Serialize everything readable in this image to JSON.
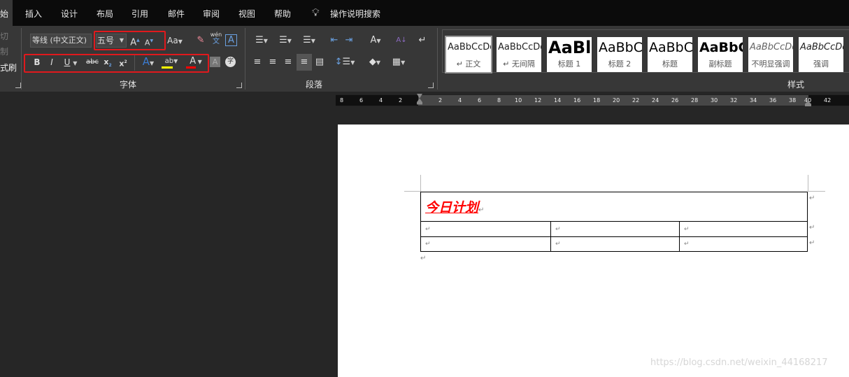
{
  "tabs": [
    "始",
    "插入",
    "设计",
    "布局",
    "引用",
    "邮件",
    "审阅",
    "视图",
    "帮助"
  ],
  "search": {
    "icon": "lightbulb-icon",
    "label": "操作说明搜索"
  },
  "clipboard": {
    "items": [
      "切",
      "制",
      "式刷"
    ]
  },
  "font": {
    "name": "等线 (中文正文)",
    "size": "五号",
    "group_label": "字体",
    "change_case": "Aa",
    "phonetic": "wén"
  },
  "paragraph": {
    "group_label": "段落"
  },
  "styles": {
    "group_label": "样式",
    "items": [
      {
        "preview": "AaBbCcDd",
        "name": "↵ 正文"
      },
      {
        "preview": "AaBbCcDd",
        "name": "↵ 无间隔"
      },
      {
        "preview": "AaBl",
        "name": "标题 1"
      },
      {
        "preview": "AaBbC",
        "name": "标题 2"
      },
      {
        "preview": "AaBbC",
        "name": "标题"
      },
      {
        "preview": "AaBbC",
        "name": "副标题"
      },
      {
        "preview": "AaBbCcDd",
        "name": "不明显强调"
      },
      {
        "preview": "AaBbCcDd",
        "name": "强调"
      }
    ]
  },
  "ruler": {
    "left": [
      "8",
      "6",
      "4",
      "2"
    ],
    "right": [
      "2",
      "4",
      "6",
      "8",
      "10",
      "12",
      "14",
      "16",
      "18",
      "20",
      "22",
      "24",
      "26",
      "28",
      "30",
      "32",
      "34",
      "36",
      "38",
      "40",
      "42"
    ]
  },
  "document": {
    "title": "今日计划",
    "title_color": "#ff0000",
    "mark": "↵"
  },
  "watermark": "https://blog.csdn.net/weixin_44168217",
  "colors": {
    "highlight": "#ffff00",
    "font_color": "#ff0000",
    "annotation": "#e0191d"
  }
}
